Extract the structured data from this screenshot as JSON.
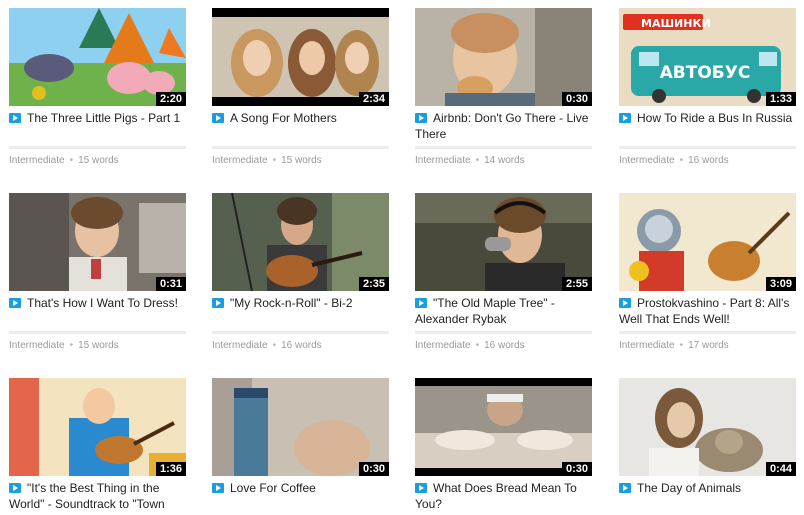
{
  "videos": [
    {
      "title": "The Three Little Pigs - Part 1",
      "duration": "2:20",
      "level": "Intermediate",
      "words": "15 words"
    },
    {
      "title": "A Song For Mothers",
      "duration": "2:34",
      "level": "Intermediate",
      "words": "15 words"
    },
    {
      "title": "Airbnb: Don't Go There - Live There",
      "duration": "0:30",
      "level": "Intermediate",
      "words": "14 words"
    },
    {
      "title": "How To Ride a Bus In Russia",
      "duration": "1:33",
      "level": "Intermediate",
      "words": "16 words",
      "thumb_text_top": "МАШИНКИ",
      "thumb_text_main": "АВТОБУС"
    },
    {
      "title": "That's How I Want To Dress!",
      "duration": "0:31",
      "level": "Intermediate",
      "words": "15 words"
    },
    {
      "title": "\"My Rock-n-Roll\" - Bi-2",
      "duration": "2:35",
      "level": "Intermediate",
      "words": "16 words"
    },
    {
      "title": "\"The Old Maple Tree\" - Alexander Rybak",
      "duration": "2:55",
      "level": "Intermediate",
      "words": "16 words"
    },
    {
      "title": "Prostokvashino - Part 8: All's Well That Ends Well!",
      "duration": "3:09",
      "level": "Intermediate",
      "words": "17 words"
    },
    {
      "title": "\"It's the Best Thing in the World\" - Soundtrack to \"Town",
      "duration": "1:36"
    },
    {
      "title": "Love For Coffee",
      "duration": "0:30"
    },
    {
      "title": "What Does Bread Mean To You?",
      "duration": "0:30"
    },
    {
      "title": "The Day of Animals",
      "duration": "0:44"
    }
  ]
}
